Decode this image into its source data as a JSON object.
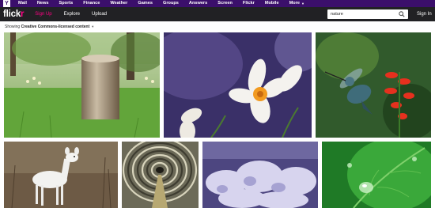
{
  "topbar": {
    "yahoo_icon": "Y",
    "links": [
      "Mail",
      "News",
      "Sports",
      "Finance",
      "Weather",
      "Games",
      "Groups",
      "Answers",
      "Screen",
      "Flickr",
      "Mobile"
    ],
    "more_label": "More"
  },
  "nav": {
    "logo_main": "flick",
    "logo_dot": "r",
    "signup_label": "Sign Up",
    "explore_label": "Explore",
    "upload_label": "Upload",
    "search_value": "nature",
    "signin_label": "Sign In"
  },
  "filter": {
    "prefix": "Showing ",
    "value": "Creative Commons-licensed content"
  },
  "photos": [
    {
      "name": "tree-stump-photo",
      "subject": "tree stump with daffodils"
    },
    {
      "name": "daffodils-photo",
      "subject": "white daffodils"
    },
    {
      "name": "hummingbird-photo",
      "subject": "hummingbird with red flowers"
    },
    {
      "name": "white-deer-photo",
      "subject": "white deer"
    },
    {
      "name": "tunnel-photo",
      "subject": "spiral tunnel"
    },
    {
      "name": "frost-plant-photo",
      "subject": "frosted lavender plant"
    },
    {
      "name": "water-drop-leaf-photo",
      "subject": "water drops on green leaf"
    }
  ],
  "colors": {
    "yahoo_bar": "#3b0f6b",
    "nav_bar": "#212124",
    "flickr_pink": "#ff0084",
    "flickr_blue": "#0063dc"
  }
}
